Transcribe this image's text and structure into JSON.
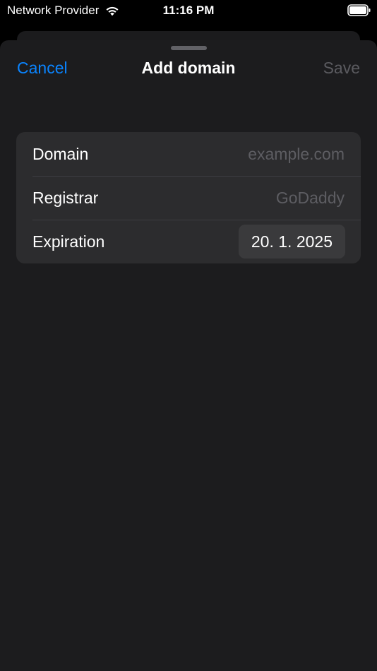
{
  "status_bar": {
    "carrier": "Network Provider",
    "time": "11:16 PM",
    "icons": [
      "wifi-icon",
      "battery-icon"
    ]
  },
  "nav": {
    "cancel_label": "Cancel",
    "title": "Add domain",
    "save_label": "Save"
  },
  "form": {
    "domain": {
      "label": "Domain",
      "value": "",
      "placeholder": "example.com"
    },
    "registrar": {
      "label": "Registrar",
      "value": "",
      "placeholder": "GoDaddy"
    },
    "expiration": {
      "label": "Expiration",
      "value": "20. 1. 2025"
    }
  },
  "colors": {
    "accent": "#0a84ff",
    "background": "#000000",
    "sheet": "#1c1c1e",
    "cell": "#2c2c2e",
    "disabled": "#5b5b60"
  }
}
